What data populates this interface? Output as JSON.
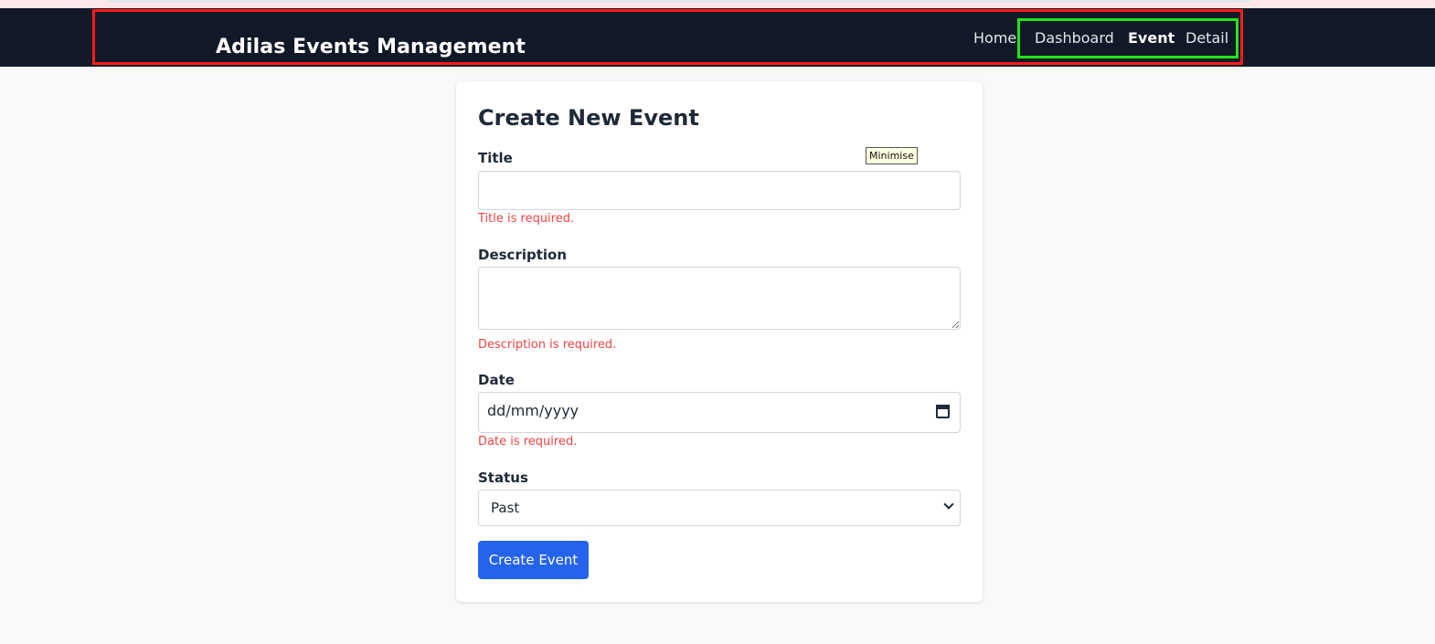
{
  "navbar": {
    "brand": "Adilas Events Management",
    "links": [
      {
        "label": "Home"
      },
      {
        "label": "Dashboard"
      },
      {
        "label": "Event"
      },
      {
        "label": "Detail"
      }
    ],
    "active_link": "Event"
  },
  "tooltip": {
    "text": "Minimise"
  },
  "form": {
    "title": "Create New Event",
    "fields": {
      "title": {
        "label": "Title",
        "value": "",
        "error": "Title is required."
      },
      "description": {
        "label": "Description",
        "value": "",
        "error": "Description is required."
      },
      "date": {
        "label": "Date",
        "placeholder": "dd/mm/yyyy",
        "error": "Date is required."
      },
      "status": {
        "label": "Status",
        "selected": "Past"
      }
    },
    "submit_label": "Create Event"
  },
  "colors": {
    "navbar_bg": "#111827",
    "primary": "#2563eb",
    "error": "#ef4444",
    "highlight_red": "#ff1a1a",
    "highlight_green": "#22e51a"
  }
}
